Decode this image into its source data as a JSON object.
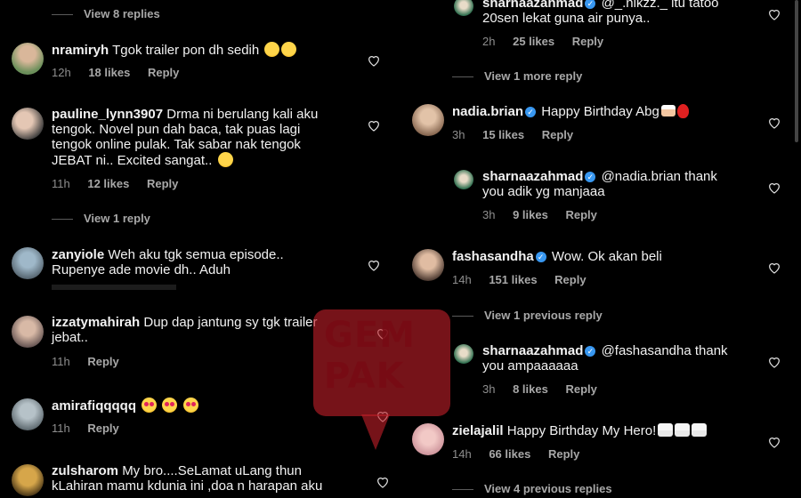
{
  "colors": {
    "background": "#000000",
    "text": "#f2f2f2",
    "meta": "#8e8e8e",
    "verified": "#3897f0",
    "watermark": "#be1e28"
  },
  "left": {
    "top_view_replies": "View 8 replies",
    "comments": [
      {
        "username": "nramiryh",
        "text": "Tgok trailer pon dh sedih",
        "time": "12h",
        "likes": "18 likes",
        "reply": "Reply"
      },
      {
        "username": "pauline_lynn3907",
        "text_lines": [
          "Drma ni berulang kali aku",
          "tengok. Novel pun dah baca, tak puas lagi",
          "tengok online pulak. Tak sabar nak tengok",
          "JEBAT ni.. Excited sangat.."
        ],
        "time": "11h",
        "likes": "12 likes",
        "reply": "Reply",
        "view_replies": "View 1 reply"
      },
      {
        "username": "zanyiole",
        "text_lines": [
          "Weh aku tgk semua episode..",
          "Rupenye ade movie dh.. Aduh"
        ]
      },
      {
        "username": "izzatymahirah",
        "text_lines": [
          "Dup dap jantung sy tgk trailer",
          "jebat.."
        ],
        "time": "11h",
        "reply": "Reply"
      },
      {
        "username": "amirafiqqqqq",
        "text": "",
        "time": "11h",
        "reply": "Reply"
      },
      {
        "username": "zulsharom",
        "text_lines": [
          "My bro....SeLamat uLang thun",
          "kLahiran mamu kdunia ini ,doa n harapan aku"
        ]
      }
    ]
  },
  "right": {
    "c0": {
      "username": "sharnaazahmad",
      "mention": "@_.nikzz._ itu tatoo",
      "line2": "20sen lekat guna air punya..",
      "time": "2h",
      "likes": "25 likes",
      "reply": "Reply"
    },
    "view_more_1": "View 1 more reply",
    "c1": {
      "username": "nadia.brian",
      "text": "Happy Birthday Abg",
      "time": "3h",
      "likes": "15 likes",
      "reply": "Reply"
    },
    "c2": {
      "username": "sharnaazahmad",
      "text": "@nadia.brian thank",
      "line2": "you adik yg manjaaa",
      "time": "3h",
      "likes": "9 likes",
      "reply": "Reply"
    },
    "c3": {
      "username": "fashasandha",
      "text": "Wow. Ok akan beli",
      "time": "14h",
      "likes": "151 likes",
      "reply": "Reply"
    },
    "view_prev_1": "View 1 previous reply",
    "c4": {
      "username": "sharnaazahmad",
      "text": "@fashasandha thank",
      "line2": "you ampaaaaaa",
      "time": "3h",
      "likes": "8 likes",
      "reply": "Reply"
    },
    "c5": {
      "username": "zielajalil",
      "text": "Happy Birthday My Hero!",
      "time": "14h",
      "likes": "66 likes",
      "reply": "Reply"
    },
    "view_prev_4": "View 4 previous replies"
  },
  "watermark": {
    "line1": "GEM",
    "line2": "PAK"
  },
  "icons": {
    "like": "heart-outline-icon",
    "verified": "verified-badge-icon"
  }
}
